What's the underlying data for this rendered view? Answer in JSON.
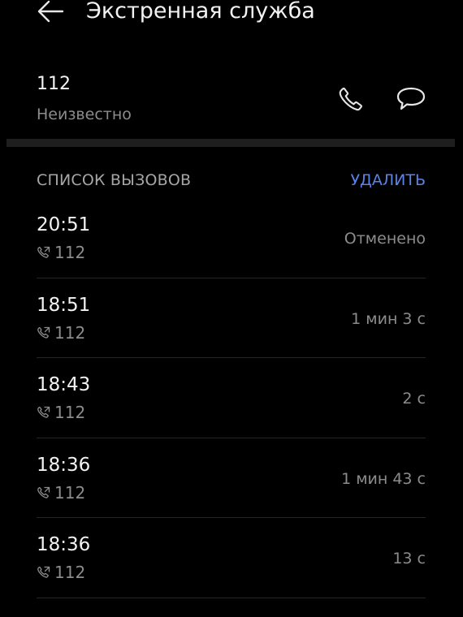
{
  "header": {
    "back_icon": "arrow-left-icon",
    "title": "Экстренная служба"
  },
  "contact": {
    "number": "112",
    "label": "Неизвестно",
    "call_icon": "phone-icon",
    "message_icon": "message-bubble-icon"
  },
  "call_log": {
    "title": "СПИСОК ВЫЗОВОВ",
    "delete_label": "УДАЛИТЬ",
    "accent_color": "#5b82e6",
    "entry_icon": "outgoing-call-icon",
    "entries": [
      {
        "time": "20:51",
        "number": "112",
        "status": "Отменено"
      },
      {
        "time": "18:51",
        "number": "112",
        "status": "1 мин 3 с"
      },
      {
        "time": "18:43",
        "number": "112",
        "status": "2 с"
      },
      {
        "time": "18:36",
        "number": "112",
        "status": "1 мин 43 с"
      },
      {
        "time": "18:36",
        "number": "112",
        "status": "13 с"
      }
    ]
  }
}
